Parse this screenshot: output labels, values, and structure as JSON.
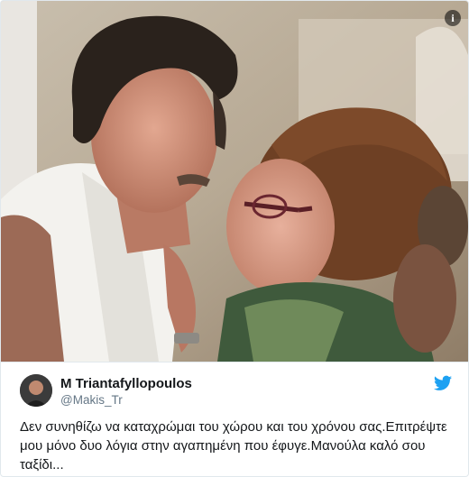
{
  "tweet": {
    "author_name": "M Triantafyllopoulos",
    "author_handle": "@Makis_Tr",
    "text": "Δεν συνηθίζω να καταχρώμαι του χώρου και του χρόνου σας.Επιτρέψτε μου μόνο δυο λόγια στην αγαπημένη που έφυγε.Μανούλα καλό σου ταξίδι..."
  },
  "icons": {
    "info": "info-icon",
    "bird": "twitter-bird-icon"
  },
  "info_glyph": "i",
  "colors": {
    "twitter_blue": "#1da1f2",
    "name_text": "#14171a",
    "handle_text": "#657786",
    "border": "#e1e8ed"
  }
}
